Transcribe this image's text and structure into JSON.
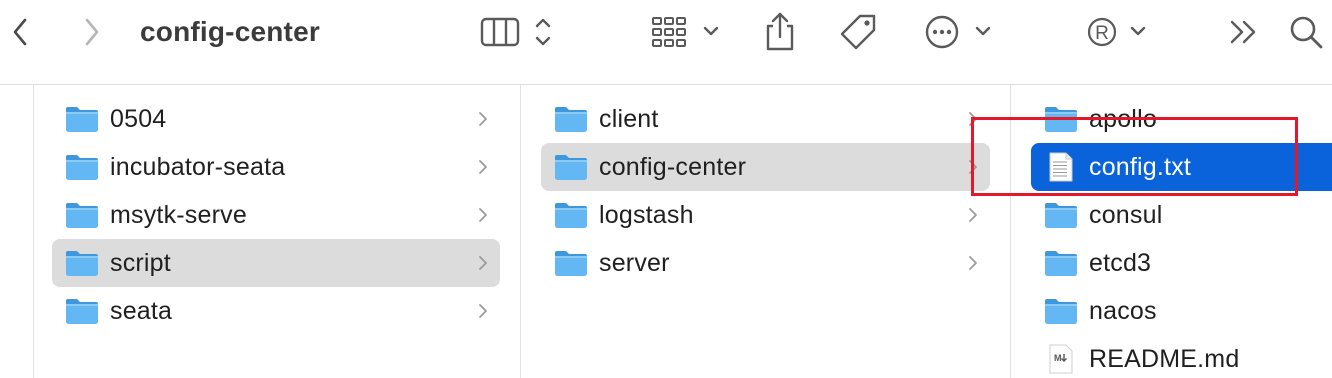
{
  "window": {
    "title": "config-center"
  },
  "toolbar": {
    "back_icon": "chevron-left-icon",
    "forward_icon": "chevron-right-icon",
    "view_icon": "columns-view-icon",
    "group_icon": "grid-group-icon",
    "share_icon": "share-icon",
    "tag_icon": "tag-icon",
    "more_icon": "ellipsis-circle-icon",
    "registered_icon": "registered-icon",
    "overflow_icon": "double-chevron-icon",
    "search_icon": "search-icon"
  },
  "columns": [
    {
      "items": [
        {
          "label": "0504",
          "type": "folder",
          "selected": "none"
        },
        {
          "label": "incubator-seata",
          "type": "folder",
          "selected": "none"
        },
        {
          "label": "msytk-serve",
          "type": "folder",
          "selected": "none"
        },
        {
          "label": "script",
          "type": "folder",
          "selected": "grey"
        },
        {
          "label": "seata",
          "type": "folder",
          "selected": "none"
        }
      ]
    },
    {
      "items": [
        {
          "label": "client",
          "type": "folder",
          "selected": "none"
        },
        {
          "label": "config-center",
          "type": "folder",
          "selected": "grey"
        },
        {
          "label": "logstash",
          "type": "folder",
          "selected": "none"
        },
        {
          "label": "server",
          "type": "folder",
          "selected": "none"
        }
      ]
    },
    {
      "items": [
        {
          "label": "apollo",
          "type": "folder",
          "selected": "none"
        },
        {
          "label": "config.txt",
          "type": "text-file",
          "selected": "blue"
        },
        {
          "label": "consul",
          "type": "folder",
          "selected": "none"
        },
        {
          "label": "etcd3",
          "type": "folder",
          "selected": "none"
        },
        {
          "label": "nacos",
          "type": "folder",
          "selected": "none"
        },
        {
          "label": "README.md",
          "type": "markdown-file",
          "selected": "none"
        }
      ]
    }
  ],
  "colors": {
    "folder_blue": "#5ab2f0",
    "selection_blue": "#0a63db",
    "selection_grey": "#dcdcdc",
    "annotation_red": "#e3192b"
  }
}
